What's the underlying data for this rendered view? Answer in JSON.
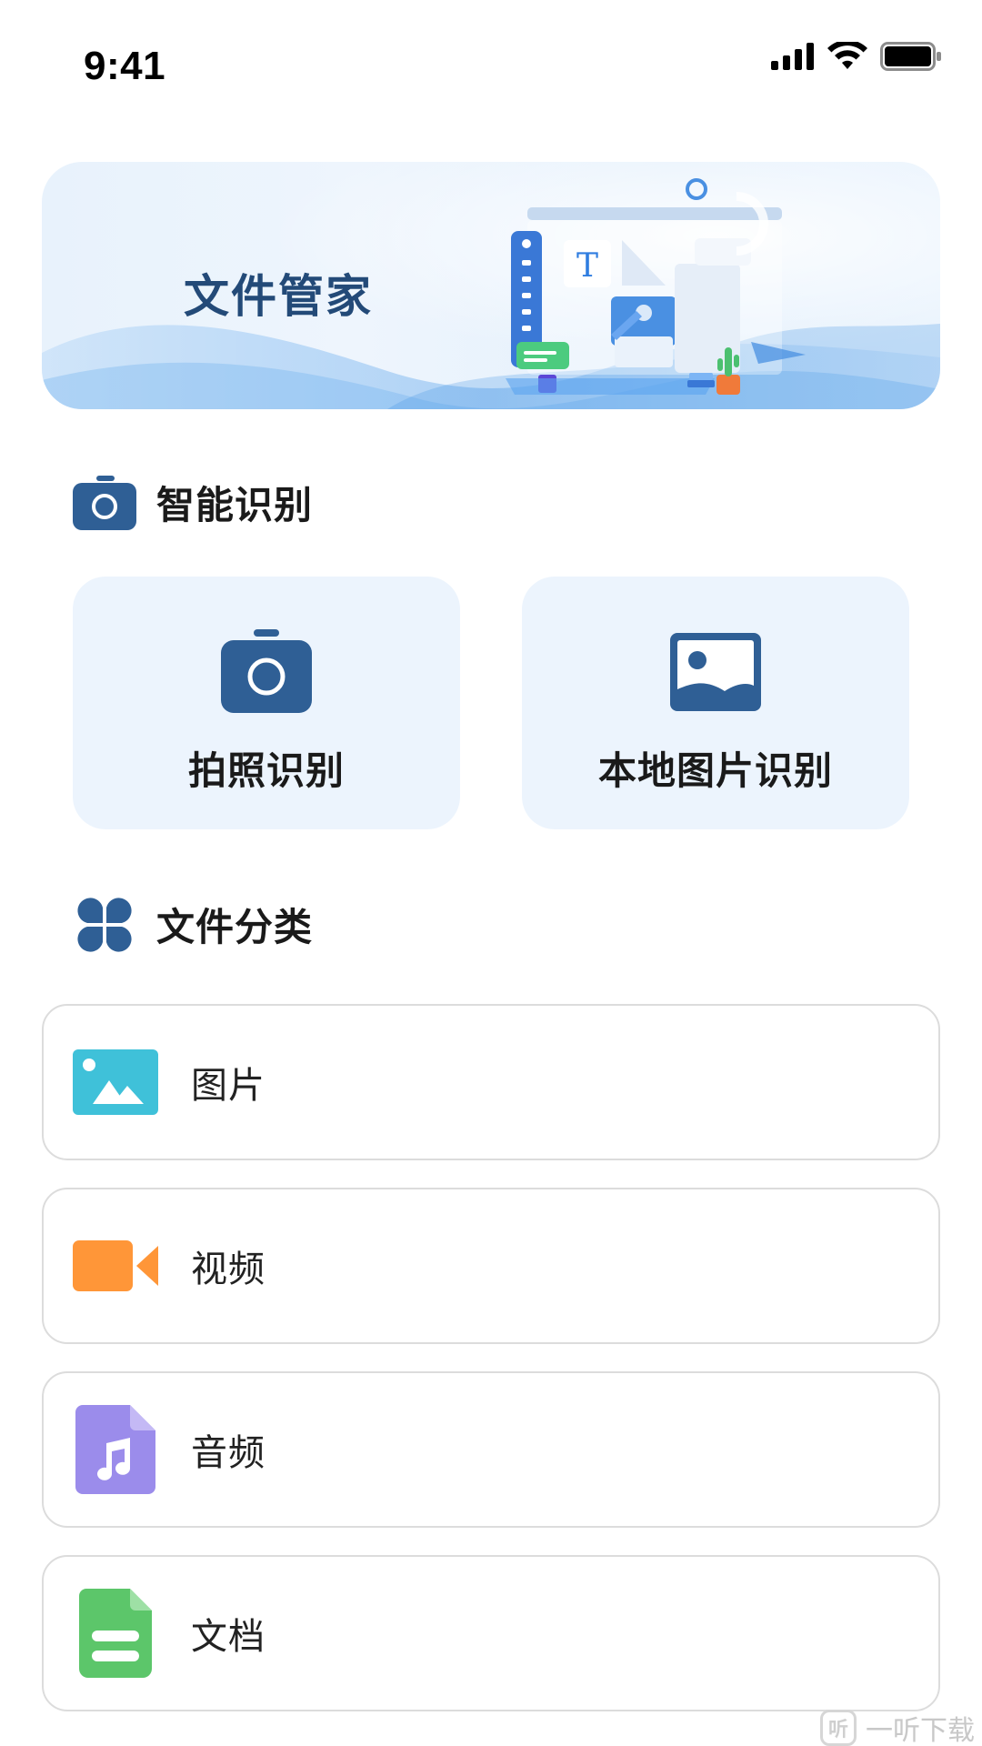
{
  "status_bar": {
    "time": "9:41"
  },
  "banner": {
    "title": "文件管家"
  },
  "recognition": {
    "section_title": "智能识别",
    "cards": [
      {
        "label": "拍照识别",
        "icon": "camera-icon"
      },
      {
        "label": "本地图片识别",
        "icon": "image-icon"
      }
    ]
  },
  "classification": {
    "section_title": "文件分类",
    "items": [
      {
        "label": "图片",
        "icon": "picture-icon",
        "color": "#3fc1d9"
      },
      {
        "label": "视频",
        "icon": "video-camera-icon",
        "color": "#ff9638"
      },
      {
        "label": "音频",
        "icon": "music-file-icon",
        "color": "#9b8ceb"
      },
      {
        "label": "文档",
        "icon": "document-file-icon",
        "color": "#5cc66a"
      }
    ]
  },
  "watermark": {
    "text": "一听下载",
    "logo_char": "听"
  },
  "colors": {
    "accent": "#2f5f95",
    "card_bg": "#ecf4fd",
    "banner_title": "#234a78"
  }
}
